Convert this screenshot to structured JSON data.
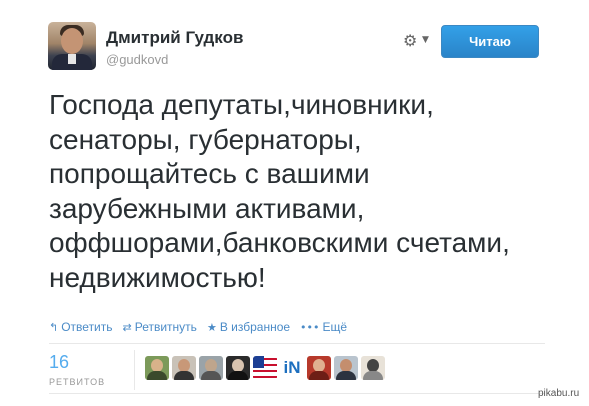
{
  "tweet": {
    "author_name": "Дмитрий Гудков",
    "author_handle": "@gudkovd",
    "follow_label": "Читаю",
    "text": "Господа депутаты,чиновники,\nсенаторы, губернаторы,\nпопрощайтесь с вашими\nзарубежными активами,\nоффшорами,банковскими счетами,\nнедвижимостью!"
  },
  "actions": {
    "reply": "Ответить",
    "retweet": "Ретвитнуть",
    "favorite": "В избранное",
    "more": "Ещё"
  },
  "stats": {
    "retweets_count": "16",
    "retweets_label": "РЕТВИТОВ"
  },
  "icons": {
    "gear": "gear-icon",
    "caret": "chevron-down-icon",
    "reply": "reply-icon",
    "retweet": "retweet-icon",
    "favorite": "star-icon",
    "more": "ellipsis-icon"
  },
  "colors": {
    "link": "#4b8bc7",
    "follow_button": "#2a84c9",
    "count": "#55acee",
    "text": "#292f33"
  },
  "watermark": "pikabu.ru"
}
